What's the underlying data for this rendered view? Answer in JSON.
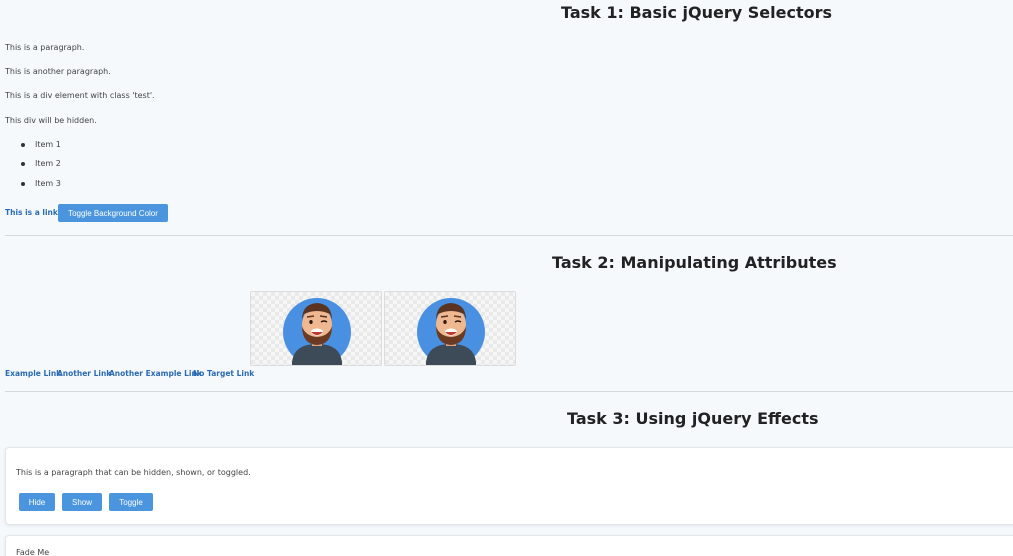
{
  "task1": {
    "title": "Task 1: Basic jQuery Selectors",
    "paragraph1": "This is a paragraph.",
    "paragraph2": "This is another paragraph.",
    "div_test": "This is a div element with class 'test'.",
    "div_hidden": "This div will be hidden.",
    "list_items": [
      "Item 1",
      "Item 2",
      "Item 3"
    ],
    "link_text": "This is a link.",
    "toggle_button": "Toggle Background Color"
  },
  "task2": {
    "title": "Task 2: Manipulating Attributes",
    "images": [
      {
        "icon": "avatar-bearded-man-icon"
      },
      {
        "icon": "avatar-bearded-man-icon"
      }
    ],
    "links": [
      "Example Link",
      "Another Link",
      "Another Example Link",
      "No Target Link"
    ]
  },
  "task3": {
    "title": "Task 3: Using jQuery Effects",
    "effect_paragraph": "This is a paragraph that can be hidden, shown, or toggled.",
    "buttons": [
      "Hide",
      "Show",
      "Toggle"
    ],
    "fade_text": "Fade Me"
  },
  "colors": {
    "background": "#f5f9fc",
    "button": "#4a95dd",
    "link": "#2b6bb3",
    "avatar_circle": "#4a90e2"
  }
}
